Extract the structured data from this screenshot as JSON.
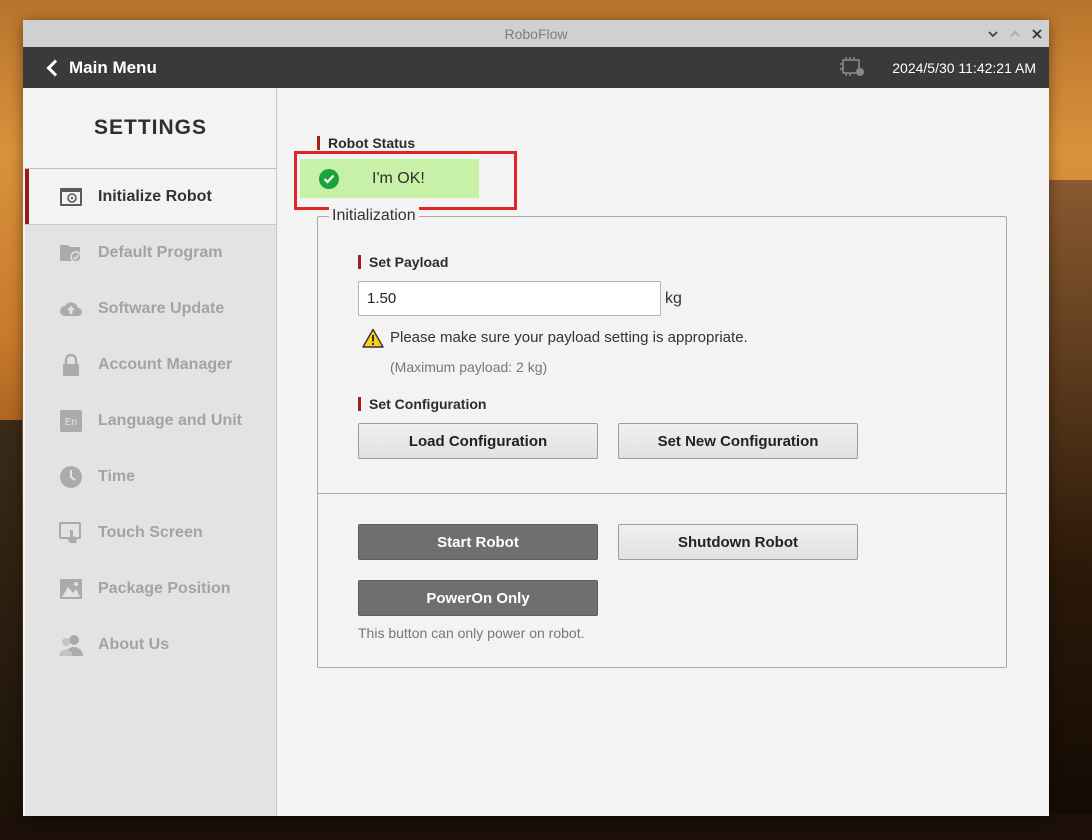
{
  "window": {
    "title": "RoboFlow",
    "controls": [
      "minimize",
      "maximize",
      "close"
    ]
  },
  "appbar": {
    "back_label": "Main Menu",
    "datetime": "2024/5/30 11:42:21 AM"
  },
  "sidebar": {
    "title": "SETTINGS",
    "items": [
      {
        "label": "Initialize Robot",
        "icon": "initialize-robot-icon",
        "active": true
      },
      {
        "label": "Default Program",
        "icon": "folder-check-icon",
        "active": false
      },
      {
        "label": "Software Update",
        "icon": "cloud-upload-icon",
        "active": false
      },
      {
        "label": "Account Manager",
        "icon": "lock-icon",
        "active": false
      },
      {
        "label": "Language and Unit",
        "icon": "language-en-icon",
        "active": false
      },
      {
        "label": "Time",
        "icon": "clock-icon",
        "active": false
      },
      {
        "label": "Touch Screen",
        "icon": "touch-screen-icon",
        "active": false
      },
      {
        "label": "Package Position",
        "icon": "package-position-icon",
        "active": false
      },
      {
        "label": "About Us",
        "icon": "users-icon",
        "active": false
      }
    ]
  },
  "main": {
    "robot_status": {
      "title": "Robot Status",
      "message": "I'm OK!",
      "color": "#c6f1a6"
    },
    "initialization": {
      "legend": "Initialization",
      "payload": {
        "title": "Set Payload",
        "value": "1.50",
        "unit": "kg",
        "warning": "Please make sure your payload setting is appropriate.",
        "max_note": "(Maximum payload: 2 kg)"
      },
      "configuration": {
        "title": "Set Configuration",
        "load_label": "Load Configuration",
        "new_label": "Set New Configuration"
      },
      "actions": {
        "start_label": "Start Robot",
        "shutdown_label": "Shutdown Robot",
        "poweron_label": "PowerOn Only",
        "poweron_note": "This button can only power on robot."
      }
    }
  },
  "colors": {
    "accent": "#a51d1d",
    "highlight_border": "#e02424",
    "ok_green": "#1aa33a",
    "appbar": "#3a3a3a"
  }
}
